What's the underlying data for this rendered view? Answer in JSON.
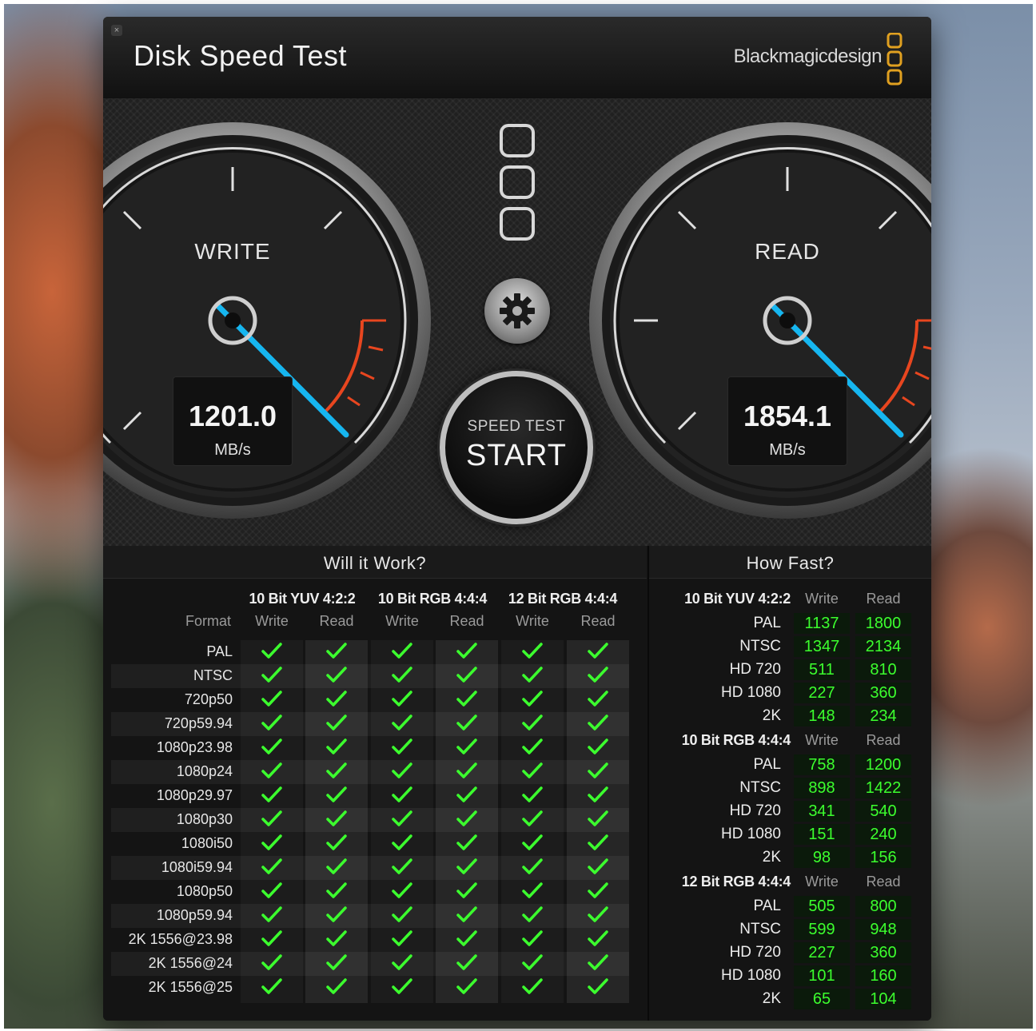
{
  "window": {
    "title": "Disk Speed Test",
    "close_glyph": "×",
    "brand": "Blackmagicdesign",
    "brand_logo_icon": "blackmagic-logo-icon"
  },
  "gauges": {
    "write": {
      "label": "WRITE",
      "value": "1201.0",
      "unit": "MB/s"
    },
    "read": {
      "label": "READ",
      "value": "1854.1",
      "unit": "MB/s"
    }
  },
  "start_button": {
    "sub": "SPEED TEST",
    "main": "START"
  },
  "settings_icon": "gear-icon",
  "colors": {
    "needle": "#16b6f0",
    "redline": "#e8461f",
    "good": "#3cff2e"
  },
  "will_it_work": {
    "title": "Will it Work?",
    "format_header": "Format",
    "groups": [
      "10 Bit YUV 4:2:2",
      "10 Bit RGB 4:4:4",
      "12 Bit RGB 4:4:4"
    ],
    "sub_headers": [
      "Write",
      "Read",
      "Write",
      "Read",
      "Write",
      "Read"
    ],
    "formats": [
      "PAL",
      "NTSC",
      "720p50",
      "720p59.94",
      "1080p23.98",
      "1080p24",
      "1080p29.97",
      "1080p30",
      "1080i50",
      "1080i59.94",
      "1080p50",
      "1080p59.94",
      "2K 1556@23.98",
      "2K 1556@24",
      "2K 1556@25"
    ],
    "status": "all-pass",
    "check_icon": "check-icon"
  },
  "how_fast": {
    "title": "How Fast?",
    "write_header": "Write",
    "read_header": "Read",
    "groups": [
      {
        "name": "10 Bit YUV 4:2:2",
        "rows": [
          {
            "format": "PAL",
            "write": "1137",
            "read": "1800"
          },
          {
            "format": "NTSC",
            "write": "1347",
            "read": "2134"
          },
          {
            "format": "HD 720",
            "write": "511",
            "read": "810"
          },
          {
            "format": "HD 1080",
            "write": "227",
            "read": "360"
          },
          {
            "format": "2K",
            "write": "148",
            "read": "234"
          }
        ]
      },
      {
        "name": "10 Bit RGB 4:4:4",
        "rows": [
          {
            "format": "PAL",
            "write": "758",
            "read": "1200"
          },
          {
            "format": "NTSC",
            "write": "898",
            "read": "1422"
          },
          {
            "format": "HD 720",
            "write": "341",
            "read": "540"
          },
          {
            "format": "HD 1080",
            "write": "151",
            "read": "240"
          },
          {
            "format": "2K",
            "write": "98",
            "read": "156"
          }
        ]
      },
      {
        "name": "12 Bit RGB 4:4:4",
        "rows": [
          {
            "format": "PAL",
            "write": "505",
            "read": "800"
          },
          {
            "format": "NTSC",
            "write": "599",
            "read": "948"
          },
          {
            "format": "HD 720",
            "write": "227",
            "read": "360"
          },
          {
            "format": "HD 1080",
            "write": "101",
            "read": "160"
          },
          {
            "format": "2K",
            "write": "65",
            "read": "104"
          }
        ]
      }
    ]
  }
}
